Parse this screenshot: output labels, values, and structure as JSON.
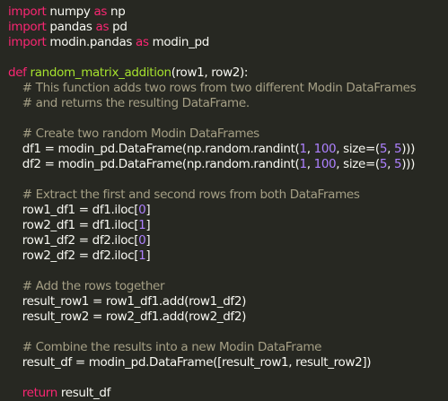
{
  "colors": {
    "background": "#272822",
    "text": "#f8f8f2",
    "keyword": "#f92672",
    "function_name": "#a6e22e",
    "number": "#ae81ff",
    "comment": "#a59f85"
  },
  "code": {
    "lines": [
      [
        {
          "t": "import",
          "c": "kw"
        },
        {
          "t": " numpy ",
          "c": "id"
        },
        {
          "t": "as",
          "c": "kw"
        },
        {
          "t": " np",
          "c": "id"
        }
      ],
      [
        {
          "t": "import",
          "c": "kw"
        },
        {
          "t": " pandas ",
          "c": "id"
        },
        {
          "t": "as",
          "c": "kw"
        },
        {
          "t": " pd",
          "c": "id"
        }
      ],
      [
        {
          "t": "import",
          "c": "kw"
        },
        {
          "t": " modin.pandas ",
          "c": "id"
        },
        {
          "t": "as",
          "c": "kw"
        },
        {
          "t": " modin_pd",
          "c": "id"
        }
      ],
      [],
      [
        {
          "t": "def",
          "c": "kw"
        },
        {
          "t": " ",
          "c": "id"
        },
        {
          "t": "random_matrix_addition",
          "c": "fn"
        },
        {
          "t": "(row1, row2):",
          "c": "id"
        }
      ],
      [
        {
          "t": "    # This function adds two rows from two different Modin DataFrames",
          "c": "cm"
        }
      ],
      [
        {
          "t": "    # and returns the resulting DataFrame.",
          "c": "cm"
        }
      ],
      [],
      [
        {
          "t": "    # Create two random Modin DataFrames",
          "c": "cm"
        }
      ],
      [
        {
          "t": "    df1 = modin_pd.DataFrame(np.random.randint(",
          "c": "id"
        },
        {
          "t": "1",
          "c": "num"
        },
        {
          "t": ", ",
          "c": "id"
        },
        {
          "t": "100",
          "c": "num"
        },
        {
          "t": ", size=(",
          "c": "id"
        },
        {
          "t": "5",
          "c": "num"
        },
        {
          "t": ", ",
          "c": "id"
        },
        {
          "t": "5",
          "c": "num"
        },
        {
          "t": ")))",
          "c": "id"
        }
      ],
      [
        {
          "t": "    df2 = modin_pd.DataFrame(np.random.randint(",
          "c": "id"
        },
        {
          "t": "1",
          "c": "num"
        },
        {
          "t": ", ",
          "c": "id"
        },
        {
          "t": "100",
          "c": "num"
        },
        {
          "t": ", size=(",
          "c": "id"
        },
        {
          "t": "5",
          "c": "num"
        },
        {
          "t": ", ",
          "c": "id"
        },
        {
          "t": "5",
          "c": "num"
        },
        {
          "t": ")))",
          "c": "id"
        }
      ],
      [],
      [
        {
          "t": "    # Extract the first and second rows from both DataFrames",
          "c": "cm"
        }
      ],
      [
        {
          "t": "    row1_df1 = df1.iloc[",
          "c": "id"
        },
        {
          "t": "0",
          "c": "num"
        },
        {
          "t": "]",
          "c": "id"
        }
      ],
      [
        {
          "t": "    row2_df1 = df1.iloc[",
          "c": "id"
        },
        {
          "t": "1",
          "c": "num"
        },
        {
          "t": "]",
          "c": "id"
        }
      ],
      [
        {
          "t": "    row1_df2 = df2.iloc[",
          "c": "id"
        },
        {
          "t": "0",
          "c": "num"
        },
        {
          "t": "]",
          "c": "id"
        }
      ],
      [
        {
          "t": "    row2_df2 = df2.iloc[",
          "c": "id"
        },
        {
          "t": "1",
          "c": "num"
        },
        {
          "t": "]",
          "c": "id"
        }
      ],
      [],
      [
        {
          "t": "    # Add the rows together",
          "c": "cm"
        }
      ],
      [
        {
          "t": "    result_row1 = row1_df1.add(row1_df2)",
          "c": "id"
        }
      ],
      [
        {
          "t": "    result_row2 = row2_df1.add(row2_df2)",
          "c": "id"
        }
      ],
      [],
      [
        {
          "t": "    # Combine the results into a new Modin DataFrame",
          "c": "cm"
        }
      ],
      [
        {
          "t": "    result_df = modin_pd.DataFrame([result_row1, result_row2])",
          "c": "id"
        }
      ],
      [],
      [
        {
          "t": "    ",
          "c": "id"
        },
        {
          "t": "return",
          "c": "kw"
        },
        {
          "t": " result_df",
          "c": "id"
        }
      ]
    ]
  }
}
